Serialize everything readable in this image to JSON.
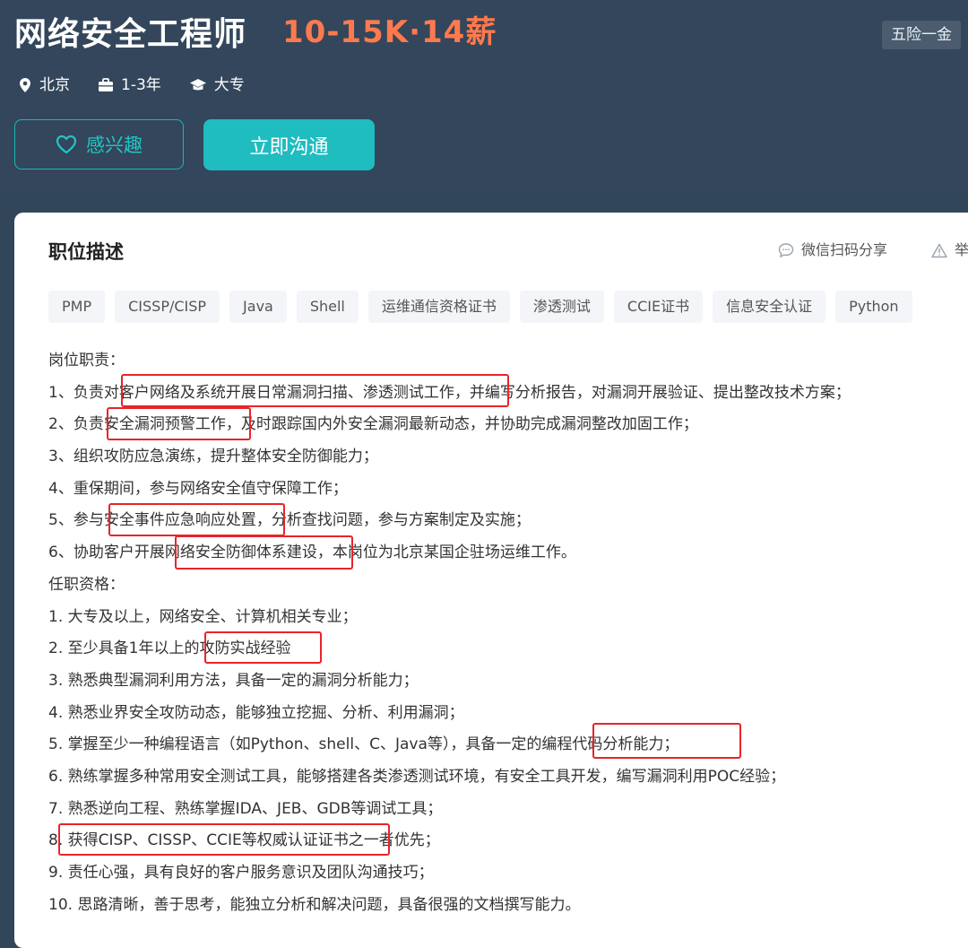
{
  "job": {
    "title": "网络安全工程师",
    "salary": "10-15K·14薪",
    "benefit": "五险一金",
    "location": "北京",
    "experience": "1-3年",
    "education": "大专"
  },
  "actions": {
    "interest_label": "感兴趣",
    "chat_label": "立即沟通"
  },
  "section": {
    "title": "职位描述",
    "share_label": "微信扫码分享",
    "report_label": "举"
  },
  "tags": [
    "PMP",
    "CISSP/CISP",
    "Java",
    "Shell",
    "运维通信资格证书",
    "渗透测试",
    "CCIE证书",
    "信息安全认证",
    "Python"
  ],
  "description": {
    "lines": [
      "岗位职责：",
      "1、负责对客户网络及系统开展日常漏洞扫描、渗透测试工作，并编写分析报告，对漏洞开展验证、提出整改技术方案；",
      "2、负责安全漏洞预警工作，及时跟踪国内外安全漏洞最新动态，并协助完成漏洞整改加固工作；",
      "3、组织攻防应急演练，提升整体安全防御能力；",
      "4、重保期间，参与网络安全值守保障工作；",
      "5、参与安全事件应急响应处置，分析查找问题，参与方案制定及实施；",
      "6、协助客户开展网络安全防御体系建设，本岗位为北京某国企驻场运维工作。",
      "任职资格：",
      "1. 大专及以上，网络安全、计算机相关专业；",
      "2. 至少具备1年以上的攻防实战经验",
      "3. 熟悉典型漏洞利用方法，具备一定的漏洞分析能力；",
      "4. 熟悉业界安全攻防动态，能够独立挖掘、分析、利用漏洞；",
      "5. 掌握至少一种编程语言（如Python、shell、C、Java等），具备一定的编程代码分析能力；",
      "6. 熟练掌握多种常用安全测试工具，能够搭建各类渗透测试环境，有安全工具开发，编写漏洞利用POC经验；",
      "7. 熟悉逆向工程、熟练掌握IDA、JEB、GDB等调试工具；",
      "8. 获得CISP、CISSP、CCIE等权威认证证书之一者优先；",
      "9. 责任心强，具有良好的客户服务意识及团队沟通技巧；",
      "10. 思路清晰，善于思考，能独立分析和解决问题，具备很强的文档撰写能力。"
    ]
  },
  "colors": {
    "header_bg": "#33465b",
    "salary": "#fe7a4d",
    "accent": "#1fbcc0",
    "highlight_box": "#e8242a"
  }
}
